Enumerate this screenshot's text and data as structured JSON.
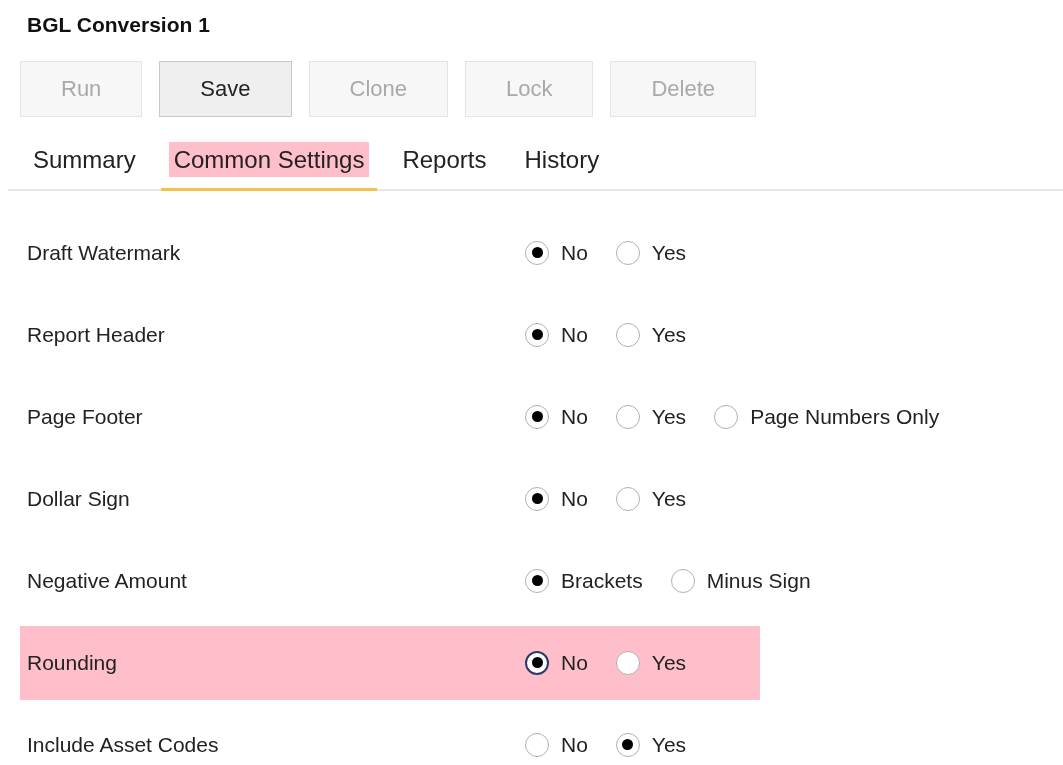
{
  "title": "BGL Conversion 1",
  "buttons": [
    {
      "label": "Run",
      "disabled": true
    },
    {
      "label": "Save",
      "disabled": false
    },
    {
      "label": "Clone",
      "disabled": true
    },
    {
      "label": "Lock",
      "disabled": true
    },
    {
      "label": "Delete",
      "disabled": true
    }
  ],
  "tabs": [
    {
      "label": "Summary",
      "selected": false,
      "highlighted": false
    },
    {
      "label": "Common Settings",
      "selected": true,
      "highlighted": true
    },
    {
      "label": "Reports",
      "selected": false,
      "highlighted": false
    },
    {
      "label": "History",
      "selected": false,
      "highlighted": false
    }
  ],
  "settings": [
    {
      "label": "Draft Watermark",
      "highlighted": false,
      "options": [
        {
          "label": "No",
          "selected": true,
          "focused": false
        },
        {
          "label": "Yes",
          "selected": false,
          "focused": false
        }
      ]
    },
    {
      "label": "Report Header",
      "highlighted": false,
      "options": [
        {
          "label": "No",
          "selected": true,
          "focused": false
        },
        {
          "label": "Yes",
          "selected": false,
          "focused": false
        }
      ]
    },
    {
      "label": "Page Footer",
      "highlighted": false,
      "options": [
        {
          "label": "No",
          "selected": true,
          "focused": false
        },
        {
          "label": "Yes",
          "selected": false,
          "focused": false
        },
        {
          "label": "Page Numbers Only",
          "selected": false,
          "focused": false
        }
      ]
    },
    {
      "label": "Dollar Sign",
      "highlighted": false,
      "options": [
        {
          "label": "No",
          "selected": true,
          "focused": false
        },
        {
          "label": "Yes",
          "selected": false,
          "focused": false
        }
      ]
    },
    {
      "label": "Negative Amount",
      "highlighted": false,
      "options": [
        {
          "label": "Brackets",
          "selected": true,
          "focused": false
        },
        {
          "label": "Minus Sign",
          "selected": false,
          "focused": false
        }
      ]
    },
    {
      "label": "Rounding",
      "highlighted": true,
      "options": [
        {
          "label": "No",
          "selected": true,
          "focused": true
        },
        {
          "label": "Yes",
          "selected": false,
          "focused": false
        }
      ]
    },
    {
      "label": "Include Asset Codes",
      "highlighted": false,
      "options": [
        {
          "label": "No",
          "selected": false,
          "focused": false
        },
        {
          "label": "Yes",
          "selected": true,
          "focused": false
        }
      ]
    }
  ]
}
